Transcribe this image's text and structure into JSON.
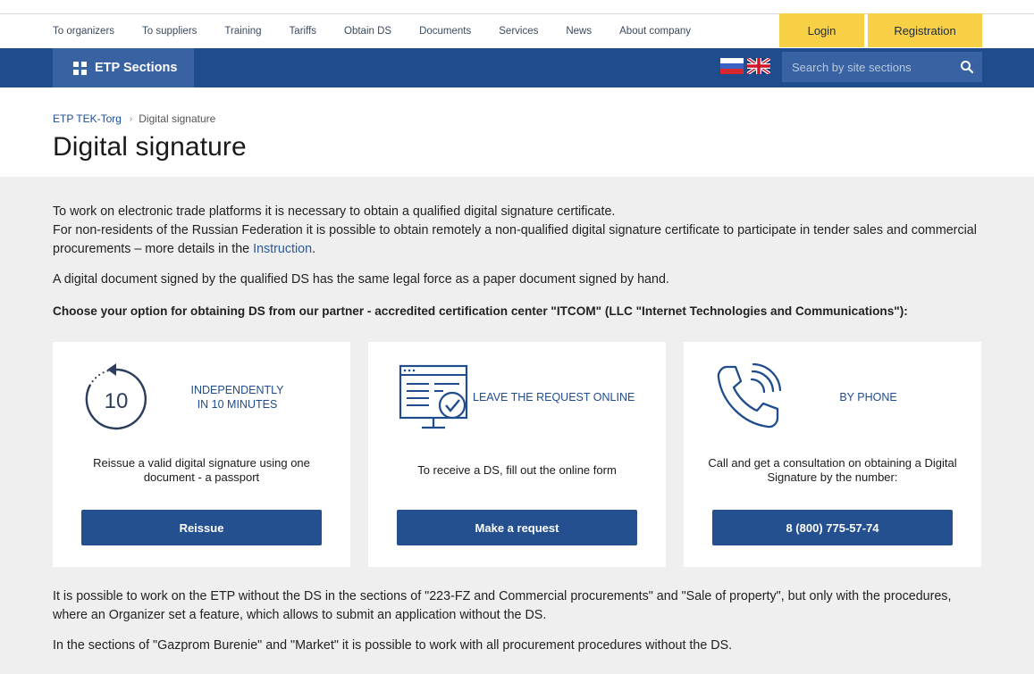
{
  "topnav": {
    "items": [
      "To organizers",
      "To suppliers",
      "Training",
      "Tariffs",
      "Obtain DS",
      "Documents",
      "Services",
      "News",
      "About company"
    ],
    "login": "Login",
    "registration": "Registration"
  },
  "bar": {
    "sections_label": "ETP Sections",
    "search_placeholder": "Search by site sections"
  },
  "breadcrumb": {
    "home": "ETP TEK-Torg",
    "current": "Digital signature"
  },
  "page_title": "Digital signature",
  "intro": {
    "p1_line1": "To work on electronic trade platforms it is necessary to obtain a qualified digital signature certificate.",
    "p1_line2": "For non-residents of the Russian Federation it is possible to obtain remotely a non-qualified digital signature certificate to participate in tender sales and commercial procurements – more details in the ",
    "p1_link": "Instruction",
    "p1_end": ".",
    "p2": "A digital document signed by the qualified DS has the same legal force as a paper document signed by hand.",
    "p3": "Choose your option for obtaining DS from our partner - accredited certification center \"ITCOM\" (LLC \"Internet Technologies and Communications\"):"
  },
  "cards": [
    {
      "icon": "timer-10-icon",
      "icon_text": "10",
      "title_l1": "INDEPENDENTLY",
      "title_l2": "IN 10 MINUTES",
      "desc": "Reissue a valid digital signature using one document - a passport",
      "button": "Reissue"
    },
    {
      "icon": "online-form-icon",
      "title_l1": "LEAVE THE REQUEST ONLINE",
      "desc": "To receive a DS, fill out the online form",
      "button": "Make a request"
    },
    {
      "icon": "phone-icon",
      "title_l1": "BY PHONE",
      "desc": "Call and get a consultation on obtaining a Digital Signature by the number:",
      "button": "8 (800) 775-57-74"
    }
  ],
  "outro": {
    "p1": "It is possible to work on the ETP without the DS in the sections of \"223-FZ and Commercial procurements\" and \"Sale of property\", but only with the procedures, where an Organizer set a feature, which allows to submit an application without the DS.",
    "p2": "In the sections of \"Gazprom Burenie\" and \"Market\" it is possible to work with all procurement procedures without the DS."
  },
  "colors": {
    "brand_blue": "#1f4c8d",
    "accent_yellow": "#f7d046",
    "button_blue": "#24508f"
  }
}
